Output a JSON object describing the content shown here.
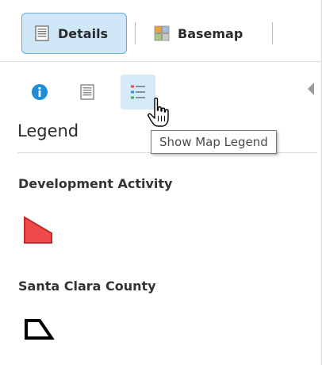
{
  "toolbar": {
    "details_label": "Details",
    "basemap_label": "Basemap"
  },
  "subbar": {
    "info_icon": "info-icon",
    "details_icon": "details-icon",
    "legend_icon": "legend-list-icon"
  },
  "tooltip": {
    "text": "Show Map Legend"
  },
  "legend": {
    "title": "Legend",
    "layers": [
      {
        "name": "Development Activity",
        "symbol": "filled-polygon",
        "fill": "#ef4a4a",
        "stroke": "#c62a2a"
      },
      {
        "name": "Santa Clara County",
        "symbol": "outline-polygon",
        "fill": "#ffffff",
        "stroke": "#000000"
      }
    ]
  },
  "colors": {
    "accent": "#1f8ed8",
    "selected_bg": "#cfe7f7",
    "selected_border": "#6aa9d6"
  }
}
